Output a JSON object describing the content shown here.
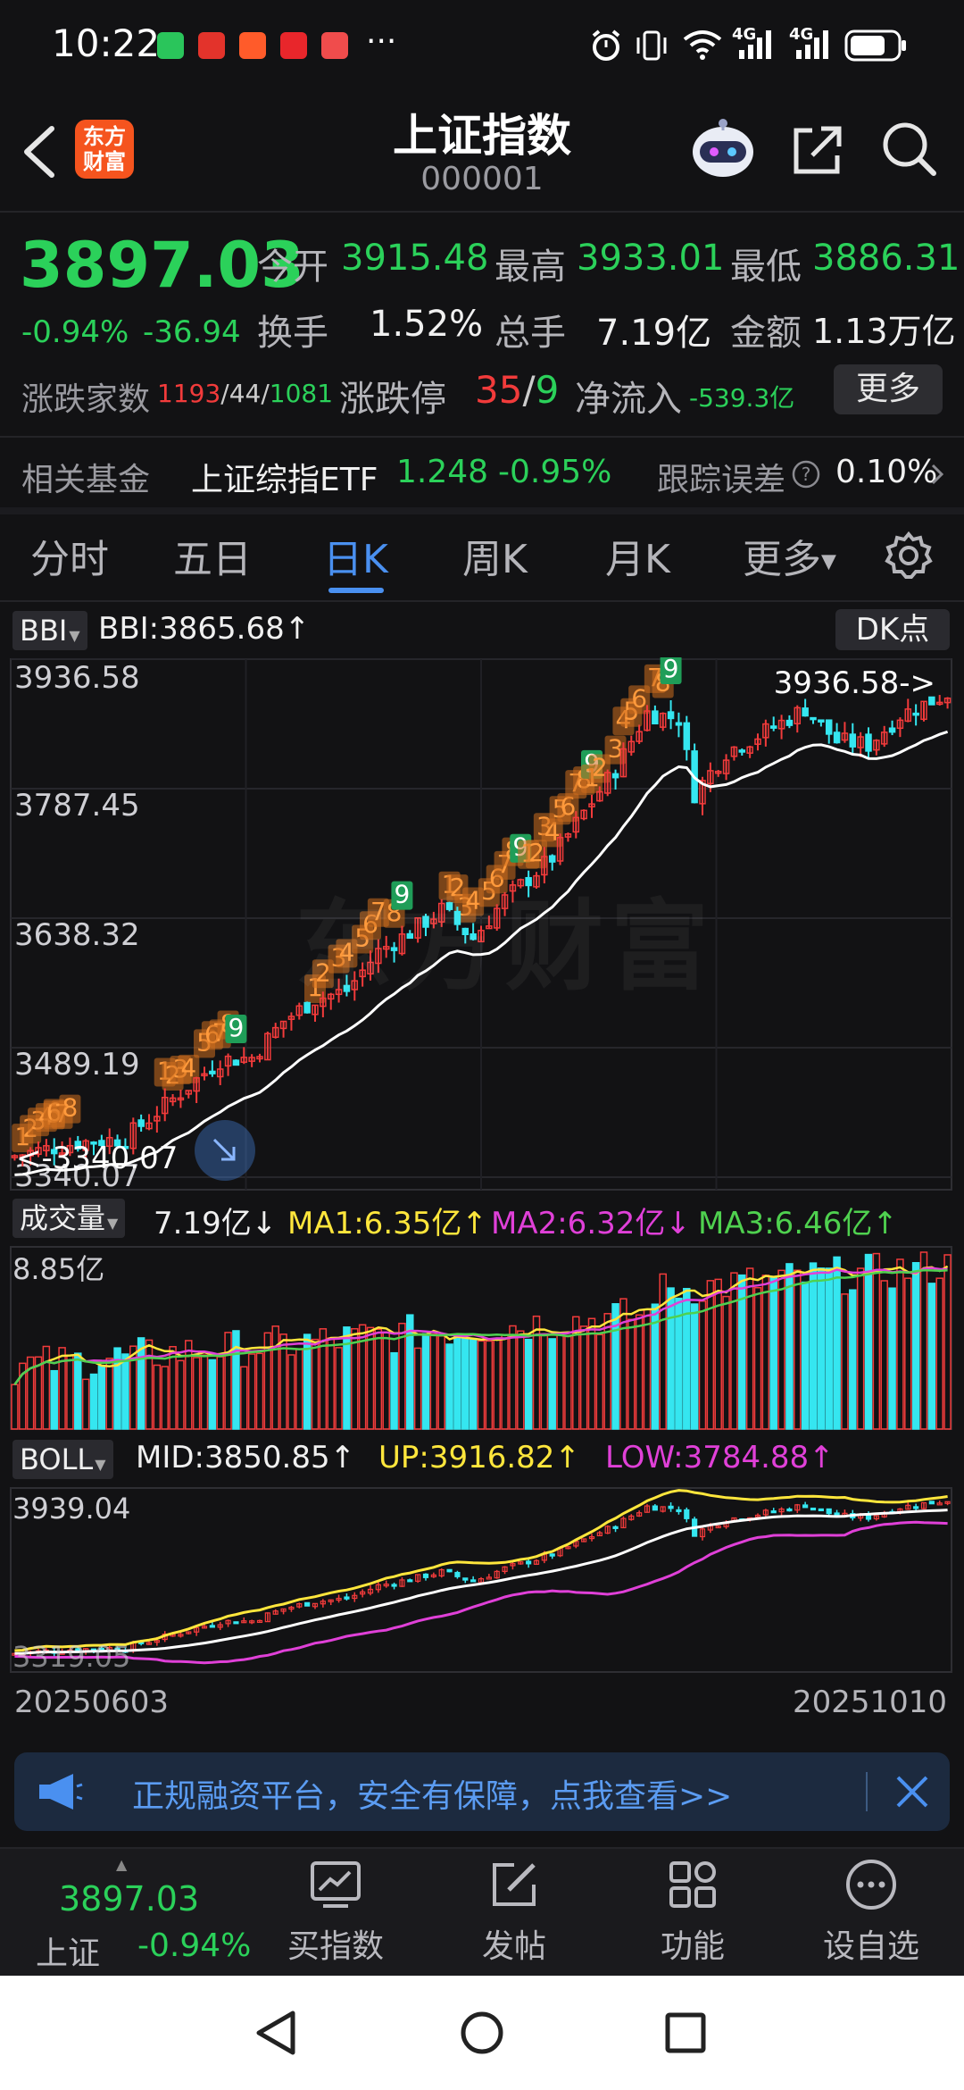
{
  "status_bar": {
    "time": "10:22",
    "more": "···",
    "sim1": "4G",
    "sim2": "4G"
  },
  "header": {
    "logo_line1": "东方",
    "logo_line2": "财富",
    "title": "上证指数",
    "code": "000001"
  },
  "quote": {
    "price": "3897.03",
    "change_pct": "-0.94%",
    "change_amt": "-36.94",
    "open_label": "今开",
    "open": "3915.48",
    "high_label": "最高",
    "high": "3933.01",
    "low_label": "最低",
    "low": "3886.31",
    "turnover_label": "换手",
    "turnover": "1.52%",
    "total_label": "总手",
    "total": "7.19亿",
    "amount_label": "金额",
    "amount": "1.13万亿",
    "breadth_label": "涨跌家数",
    "breadth_up": "1193",
    "breadth_flat": "44",
    "breadth_down": "1081",
    "limit_label": "涨跌停",
    "limit_up": "35",
    "limit_down": "9",
    "inflow_label": "净流入",
    "inflow": "-539.3亿",
    "more_button": "更多"
  },
  "fund": {
    "label": "相关基金",
    "name": "上证综指ETF",
    "price": "1.248",
    "change": "-0.95%",
    "tracking_label": "跟踪误差",
    "tracking": "0.10%"
  },
  "tabs": [
    "分时",
    "五日",
    "日K",
    "周K",
    "月K",
    "更多"
  ],
  "active_tab": 2,
  "indicator": {
    "selector": "BBI",
    "value": "BBI:3865.68↑",
    "dk_button": "DK点",
    "max_label": "3936.58->",
    "min_label": "<-3340.07",
    "watermark": "东方财富"
  },
  "volume": {
    "selector": "成交量",
    "value": "7.19亿↓",
    "ma1": "MA1:6.35亿↑",
    "ma2": "MA2:6.32亿↓",
    "ma3": "MA3:6.46亿↑",
    "max_label": "8.85亿"
  },
  "boll": {
    "selector": "BOLL",
    "mid": "MID:3850.85↑",
    "up": "UP:3916.82↑",
    "low": "LOW:3784.88↑",
    "max_label": "3939.04",
    "min_label": "3319.05"
  },
  "dates": {
    "start": "20250603",
    "end": "20251010"
  },
  "banner": {
    "text": "正规融资平台，安全有保障，点我查看>>"
  },
  "bottom_nav": {
    "index_price": "3897.03",
    "index_name": "上证",
    "index_change": "-0.94%",
    "items": [
      "买指数",
      "发帖",
      "功能",
      "设自选"
    ]
  },
  "chart_data": {
    "type": "candlestick",
    "title": "",
    "xlabel": "",
    "ylabel": "",
    "x_range": [
      "20250603",
      "20251010"
    ],
    "price_axis_ticks": [
      "3936.58",
      "3787.45",
      "3638.32",
      "3489.19",
      "3340.07"
    ],
    "ylim": [
      3340.07,
      3936.58
    ],
    "grid": true,
    "indicator_series": [
      {
        "name": "BBI",
        "last": 3865.68
      }
    ],
    "td_sequential_marks": [
      "1",
      "2",
      "3",
      "4",
      "5",
      "6",
      "7",
      "8",
      "9"
    ],
    "volume": {
      "max": "8.85亿",
      "last": "7.19亿",
      "ma": [
        "6.35亿",
        "6.32亿",
        "6.46亿"
      ]
    },
    "boll": {
      "mid": 3850.85,
      "up": 3916.82,
      "low": 3784.88,
      "ylim": [
        3319.05,
        3939.04
      ]
    }
  },
  "colors": {
    "up": "#f23b3b",
    "down": "#35e6f0",
    "ma1": "#ffe63c",
    "ma2": "#e040d8",
    "ma3": "#4fd14f",
    "accent": "#4a90f0"
  }
}
